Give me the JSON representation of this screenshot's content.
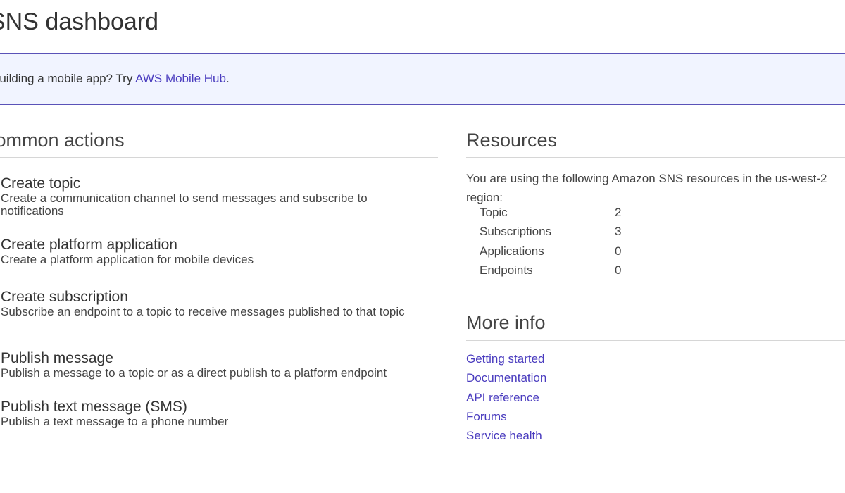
{
  "page": {
    "title": "SNS dashboard"
  },
  "banner": {
    "text_prefix": "Building a mobile app? Try ",
    "link_label": "AWS Mobile Hub",
    "text_suffix": "."
  },
  "common_actions": {
    "heading": "Common actions",
    "items": [
      {
        "title": "Create topic",
        "description": "Create a communication channel to send messages and subscribe to notifications"
      },
      {
        "title": "Create platform application",
        "description": "Create a platform application for mobile devices"
      },
      {
        "title": "Create subscription",
        "description": "Subscribe an endpoint to a topic to receive messages published to that topic"
      },
      {
        "title": "Publish message",
        "description": "Publish a message to a topic or as a direct publish to a platform endpoint"
      },
      {
        "title": "Publish text message (SMS)",
        "description": "Publish a text message to a phone number"
      }
    ]
  },
  "resources": {
    "heading": "Resources",
    "intro": "You are using the following Amazon SNS resources in the us-west-2 region:",
    "rows": [
      {
        "label": "Topic",
        "value": "2"
      },
      {
        "label": "Subscriptions",
        "value": "3"
      },
      {
        "label": "Applications",
        "value": "0"
      },
      {
        "label": "Endpoints",
        "value": "0"
      }
    ]
  },
  "more_info": {
    "heading": "More info",
    "links": [
      {
        "label": "Getting started"
      },
      {
        "label": "Documentation"
      },
      {
        "label": "API reference"
      },
      {
        "label": "Forums"
      },
      {
        "label": "Service health"
      }
    ]
  },
  "colors": {
    "link": "#4a3cbf",
    "banner_background": "#f1f4ff",
    "banner_border": "#5a52b8"
  }
}
